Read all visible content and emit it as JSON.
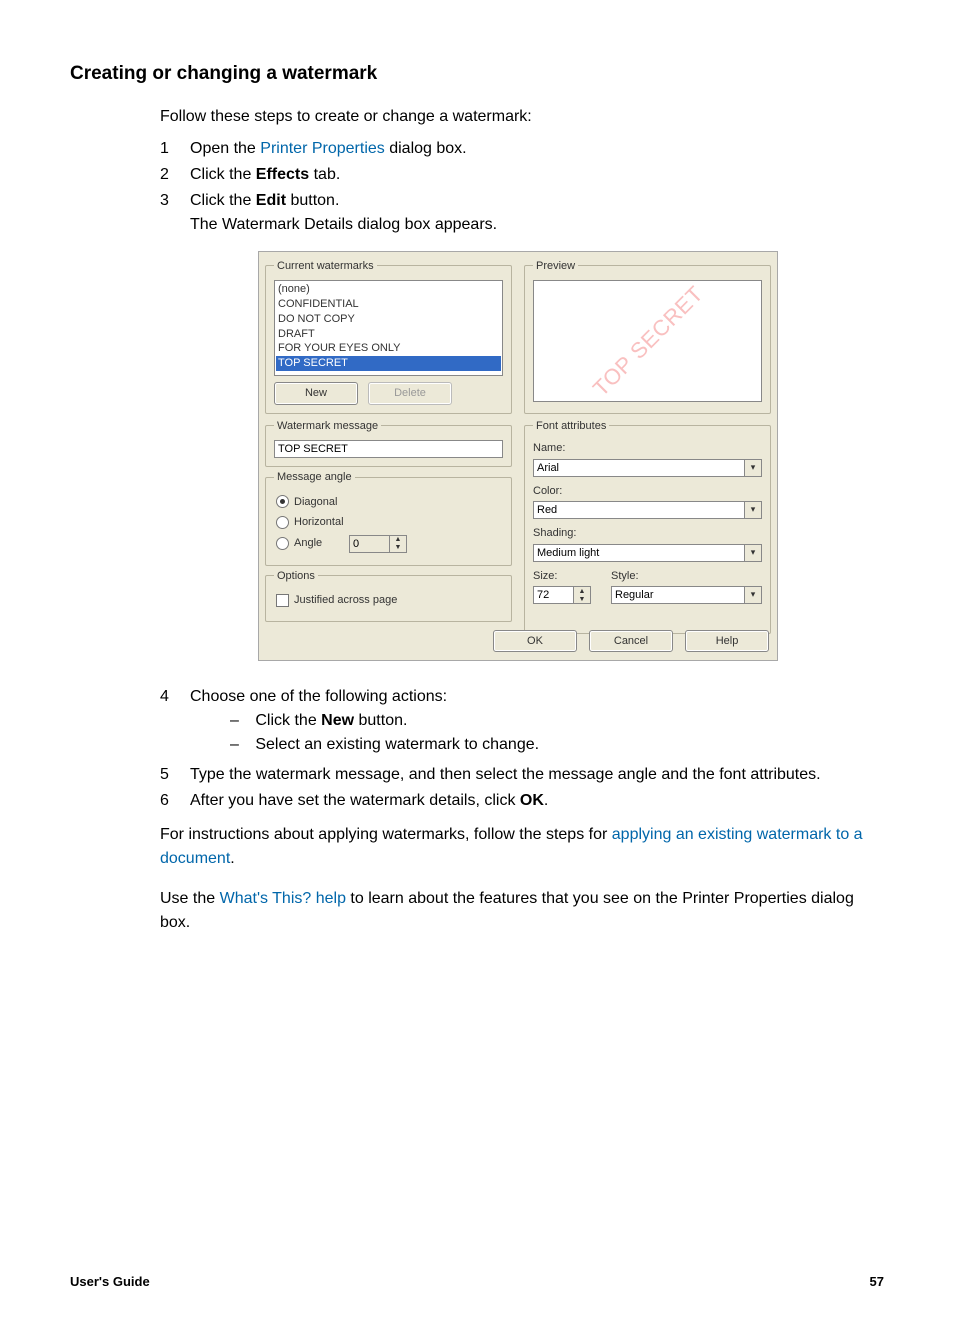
{
  "heading": "Creating or changing a watermark",
  "intro": "Follow these steps to create or change a watermark:",
  "steps_top": {
    "n1": "1",
    "t1a": "Open the ",
    "t1link": "Printer Properties",
    "t1b": " dialog box.",
    "n2": "2",
    "t2a": "Click the ",
    "t2bold": "Effects",
    "t2b": " tab.",
    "n3": "3",
    "t3a": "Click the ",
    "t3bold": "Edit",
    "t3b": " button.",
    "t3c": "The Watermark Details dialog box appears."
  },
  "dialog": {
    "current_watermarks_legend": "Current watermarks",
    "list": {
      "i0": "(none)",
      "i1": "CONFIDENTIAL",
      "i2": "DO NOT COPY",
      "i3": "DRAFT",
      "i4": "FOR YOUR EYES ONLY",
      "i5": "TOP SECRET"
    },
    "new_btn": "New",
    "delete_btn": "Delete",
    "preview_legend": "Preview",
    "preview_text": "TOP SECRET",
    "wm_message_legend": "Watermark message",
    "wm_message_value": "TOP SECRET",
    "angle_legend": "Message angle",
    "angle_diag": "Diagonal",
    "angle_horiz": "Horizontal",
    "angle_angle": "Angle",
    "angle_val": "0",
    "options_legend": "Options",
    "justified": "Justified across page",
    "font_legend": "Font attributes",
    "name_lbl": "Name:",
    "name_val": "Arial",
    "color_lbl": "Color:",
    "color_val": "Red",
    "shading_lbl": "Shading:",
    "shading_val": "Medium light",
    "size_lbl": "Size:",
    "size_val": "72",
    "style_lbl": "Style:",
    "style_val": "Regular",
    "ok": "OK",
    "cancel": "Cancel",
    "help": "Help"
  },
  "steps_bottom": {
    "n4": "4",
    "t4": "Choose one of the following actions:",
    "s4a_a": "Click the ",
    "s4a_bold": "New",
    "s4a_b": " button.",
    "s4b": "Select an existing watermark to change.",
    "n5": "5",
    "t5": "Type the watermark message, and then select the message angle and the font attributes.",
    "n6": "6",
    "t6a": "After you have set the watermark details, click ",
    "t6bold": "OK",
    "t6b": "."
  },
  "para1_a": "For instructions about applying watermarks, follow the steps for ",
  "para1_link": "applying an existing watermark to a document",
  "para1_b": ".",
  "para2_a": "Use the ",
  "para2_link": "What's This? help",
  "para2_b": " to learn about the features that you see on the Printer Properties dialog box.",
  "footer_left": "User's Guide",
  "footer_right": "57"
}
